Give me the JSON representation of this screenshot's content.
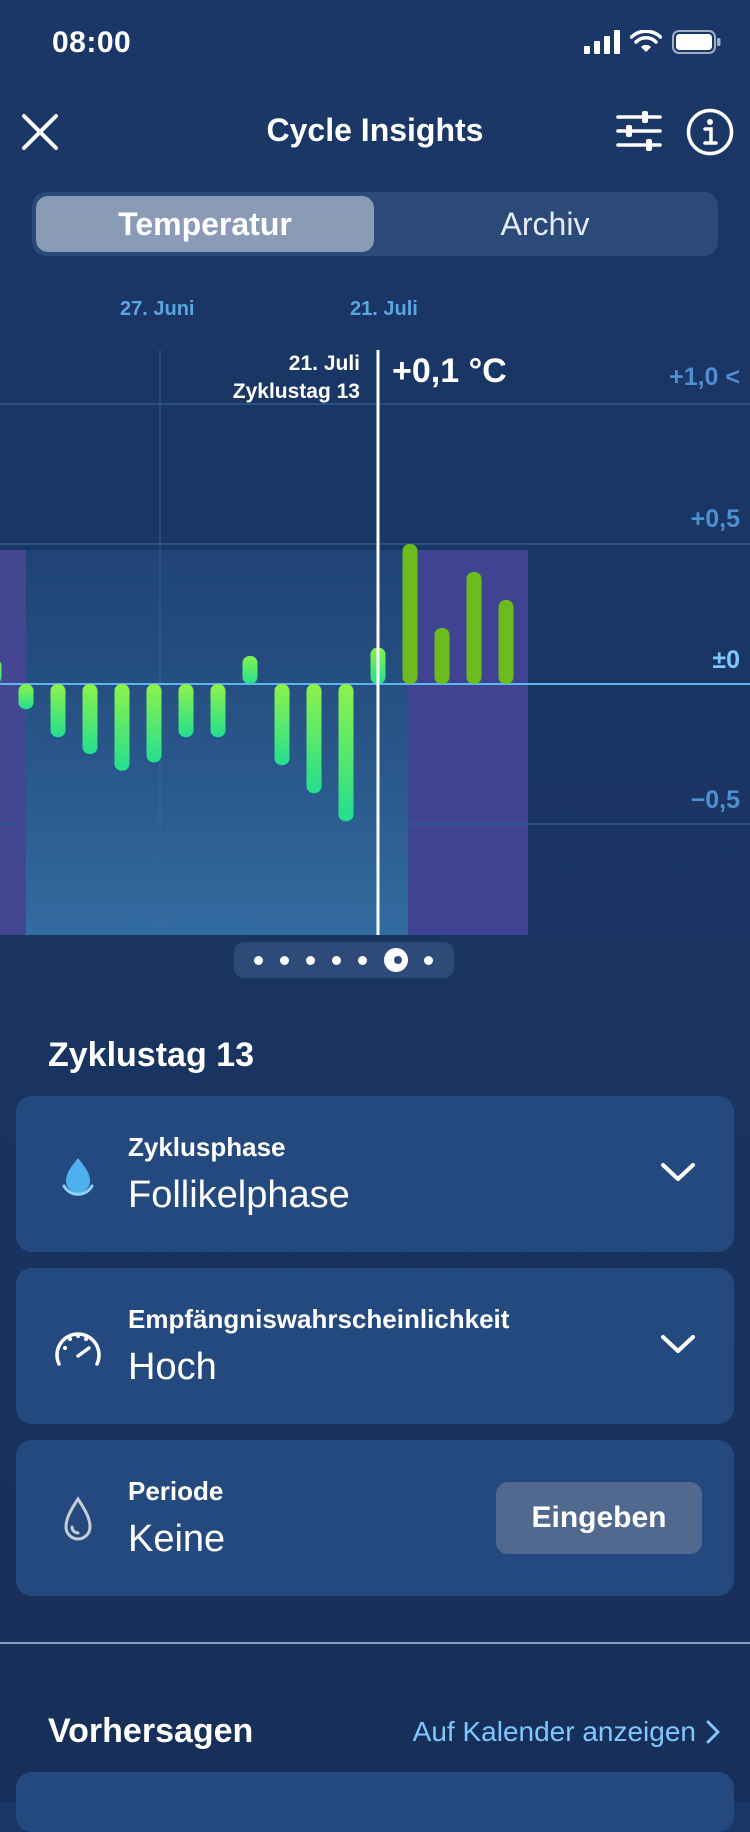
{
  "status_bar": {
    "time": "08:00"
  },
  "header": {
    "title": "Cycle Insights"
  },
  "tabs": [
    {
      "label": "Temperatur",
      "active": true
    },
    {
      "label": "Archiv",
      "active": false
    }
  ],
  "chart_data": {
    "type": "bar",
    "top_date_labels": [
      "27. Juni",
      "21. Juli"
    ],
    "selected": {
      "date": "21. Juli",
      "cycle_day": "Zyklustag 13",
      "value_label": "+0,1 °C",
      "value": 0.1
    },
    "ytick_labels": [
      "+1,0 <",
      "+0,5",
      "±0",
      "−0,5"
    ],
    "yticks": [
      1.0,
      0.5,
      0.0,
      -0.5
    ],
    "ylim": [
      -0.9,
      1.2
    ],
    "values": [
      0.09,
      -0.09,
      -0.19,
      -0.25,
      -0.31,
      -0.28,
      -0.19,
      -0.19,
      0.1,
      -0.29,
      -0.39,
      -0.49,
      0.13,
      0.5,
      0.2,
      0.4,
      0.3
    ],
    "colors": {
      "negative": "#27e08e",
      "positive_past": "#7ef24f",
      "positive_future": "#6cbc1f",
      "accent": "#5bb3ef"
    }
  },
  "pager": {
    "count": 7,
    "active_index": 5
  },
  "day_section": {
    "title": "Zyklustag 13"
  },
  "cards": [
    {
      "label": "Zyklusphase",
      "value": "Follikelphase",
      "icon": "drop-icon"
    },
    {
      "label": "Empfängniswahrscheinlichkeit",
      "value": "Hoch",
      "icon": "gauge-icon"
    },
    {
      "label": "Periode",
      "value": "Keine",
      "icon": "drop-outline-icon",
      "button": "Eingeben"
    }
  ],
  "predictions": {
    "title": "Vorhersagen",
    "link": "Auf Kalender anzeigen"
  }
}
